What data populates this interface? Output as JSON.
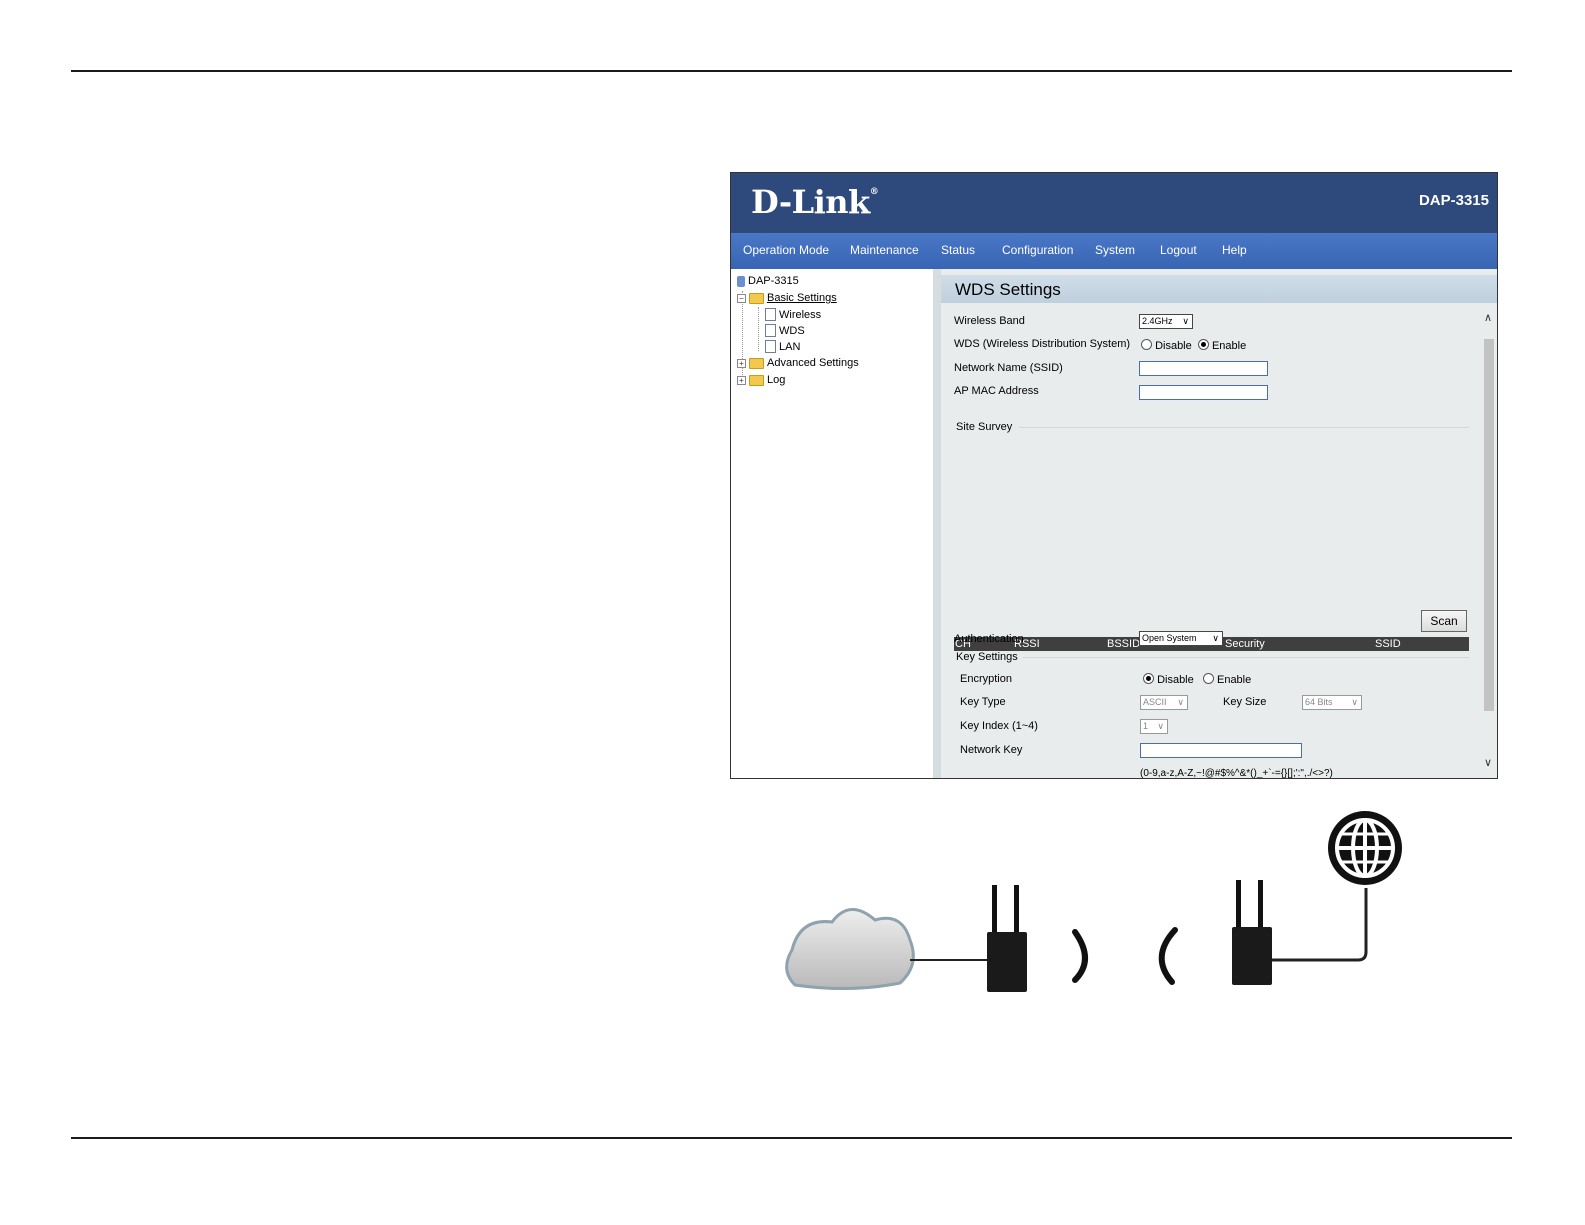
{
  "header": {
    "logo": "D-Link",
    "logo_mark": "®",
    "model": "DAP-3315"
  },
  "nav": [
    "Operation Mode",
    "Maintenance",
    "Status",
    "Configuration",
    "System",
    "Logout",
    "Help"
  ],
  "tree": {
    "root": "DAP-3315",
    "basic": "Basic Settings",
    "wireless": "Wireless",
    "wds": "WDS",
    "lan": "LAN",
    "advanced": "Advanced Settings",
    "log": "Log"
  },
  "form": {
    "title": "WDS Settings",
    "wireless_band_label": "Wireless Band",
    "wireless_band_value": "2.4GHz",
    "wds_label": "WDS (Wireless Distribution System)",
    "wds_disable": "Disable",
    "wds_enable": "Enable",
    "wds_selected": "Enable",
    "ssid_label": "Network Name (SSID)",
    "ssid_value": "",
    "mac_label": "AP MAC Address",
    "mac_value": "",
    "site_survey": "Site Survey",
    "scan_button": "Scan",
    "columns": [
      "CH",
      "RSSI",
      "BSSID",
      "Security",
      "SSID"
    ],
    "auth_label": "Authentication",
    "auth_value": "Open System",
    "key_settings": "Key Settings",
    "encryption_label": "Encryption",
    "enc_disable": "Disable",
    "enc_enable": "Enable",
    "enc_selected": "Disable",
    "key_type_label": "Key Type",
    "key_type_value": "ASCII",
    "key_size_label": "Key Size",
    "key_size_value": "64 Bits",
    "key_index_label": "Key Index (1~4)",
    "key_index_value": "1",
    "network_key_label": "Network Key",
    "network_key_value": "",
    "key_hint": "(0-9,a-z,A-Z,~!@#$%^&*()_+`-={}[];':\",./<>?)"
  },
  "colors": {
    "header": "#2e4a7c",
    "nav": "#3f6cbd",
    "table_header": "#3f3f3f"
  },
  "diagram_icons": [
    "cloud-icon",
    "access-point-icon",
    "signal-waves-icon",
    "access-point-icon",
    "globe-icon"
  ]
}
